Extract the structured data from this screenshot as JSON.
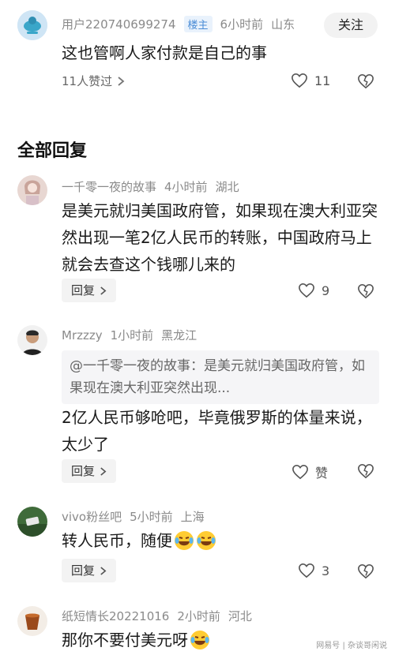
{
  "top_comment": {
    "username": "用户220740699274",
    "badge": "楼主",
    "time": "6小时前",
    "location": "山东",
    "follow_label": "关注",
    "text": "这也管啊人家付款是自己的事",
    "likes_summary": "11人赞过",
    "like_count": "11"
  },
  "section_title": "全部回复",
  "replies": [
    {
      "username": "一千零一夜的故事",
      "time": "4小时前",
      "location": "湖北",
      "text": "是美元就归美国政府管，如果现在澳大利亚突然出现一笔2亿人民币的转账，中国政府马上就会去查这个钱哪儿来的",
      "reply_label": "回复",
      "like_count": "9"
    },
    {
      "username": "Mrzzzy",
      "time": "1小时前",
      "location": "黑龙江",
      "quote": "@一千零一夜的故事：是美元就归美国政府管，如果现在澳大利亚突然出现...",
      "text": "2亿人民币够呛吧，毕竟俄罗斯的体量来说，太少了",
      "reply_label": "回复",
      "like_count": "赞"
    },
    {
      "username": "vivo粉丝吧",
      "time": "5小时前",
      "location": "上海",
      "text": "转人民币，随便",
      "reply_label": "回复",
      "like_count": "3"
    },
    {
      "username": "纸短情长20221016",
      "time": "2小时前",
      "location": "河北",
      "text": "那你不要付美元呀"
    }
  ],
  "watermark": "网易号 | 杂谈哥闲说",
  "colors": {
    "badge": "#4a8cd6",
    "meta": "#8a8a8a"
  }
}
